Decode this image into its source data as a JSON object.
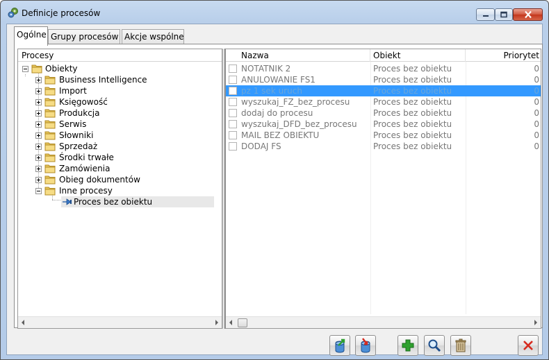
{
  "window": {
    "title": "Definicje procesów",
    "app_icon": "gears-icon",
    "controls": [
      "minimize-icon",
      "maximize-icon",
      "close-icon"
    ]
  },
  "tabs": [
    {
      "label": "Ogólne",
      "active": true
    },
    {
      "label": "Grupy procesów",
      "active": false
    },
    {
      "label": "Akcje wspólne",
      "active": false
    }
  ],
  "tree": {
    "header": "Procesy",
    "root": {
      "label": "Obiekty",
      "expanded": true
    },
    "children": [
      {
        "label": "Business Intelligence"
      },
      {
        "label": "Import"
      },
      {
        "label": "Księgowość"
      },
      {
        "label": "Produkcja"
      },
      {
        "label": "Serwis"
      },
      {
        "label": "Słowniki"
      },
      {
        "label": "Sprzedaż"
      },
      {
        "label": "Środki trwałe"
      },
      {
        "label": "Zamówienia"
      },
      {
        "label": "Obieg dokumentów"
      },
      {
        "label": "Inne procesy",
        "expanded": true
      }
    ],
    "leaf": {
      "label": "Proces bez obiektu",
      "icon": "process-node-icon",
      "selected": true
    }
  },
  "grid": {
    "columns": [
      "Nazwa",
      "Obiekt",
      "Priorytet"
    ],
    "rows": [
      {
        "name": "NOTATNIK 2",
        "object": "Proces bez obiektu",
        "priority": "0",
        "selected": false
      },
      {
        "name": "ANULOWANIE FS1",
        "object": "Proces bez obiektu",
        "priority": "0",
        "selected": false
      },
      {
        "name": "pz 1 sek uruch",
        "object": "Proces bez obiektu",
        "priority": "0",
        "selected": true
      },
      {
        "name": "wyszukaj_FZ_bez_procesu",
        "object": "Proces bez obiektu",
        "priority": "0",
        "selected": false
      },
      {
        "name": "dodaj do procesu",
        "object": "Proces bez obiektu",
        "priority": "0",
        "selected": false
      },
      {
        "name": "wyszukaj_DFD_bez_procesu",
        "object": "Proces bez obiektu",
        "priority": "0",
        "selected": false
      },
      {
        "name": "MAIL BEZ OBIEKTU",
        "object": "Proces bez obiektu",
        "priority": "0",
        "selected": false
      },
      {
        "name": "DODAJ FS",
        "object": "Proces bez obiektu",
        "priority": "0",
        "selected": false
      }
    ]
  },
  "toolbar": {
    "buttons": [
      "export-icon",
      "import-icon",
      "add-icon",
      "search-icon",
      "delete-icon",
      "close-icon"
    ]
  },
  "colors": {
    "selection": "#3399ff",
    "add_green": "#2fa12f",
    "close_red": "#d62b1f"
  }
}
